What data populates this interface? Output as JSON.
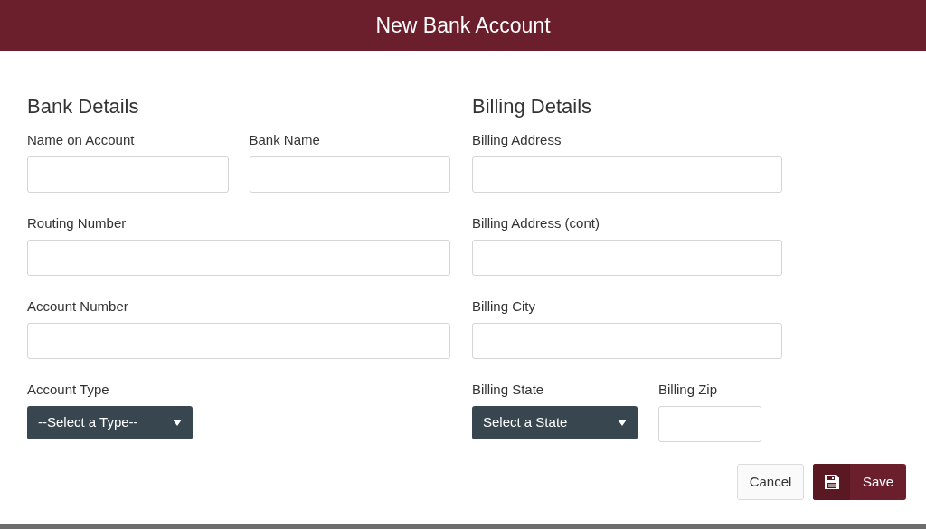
{
  "window": {
    "title": "New Bank Account"
  },
  "sections": [
    {
      "title": "Bank Details",
      "rows": [
        [
          {
            "label": "Name on Account",
            "kind": "text"
          },
          {
            "label": "Bank Name",
            "kind": "text"
          }
        ],
        [
          {
            "label": "Routing Number",
            "kind": "text"
          }
        ],
        [
          {
            "label": "Account Number",
            "kind": "text"
          }
        ],
        [
          {
            "label": "Account Type",
            "kind": "select",
            "value": "--Select a Type--"
          }
        ]
      ]
    },
    {
      "title": "Billing Details",
      "rows": [
        [
          {
            "label": "Billing Address",
            "kind": "text"
          }
        ],
        [
          {
            "label": "Billing Address (cont)",
            "kind": "text"
          }
        ],
        [
          {
            "label": "Billing City",
            "kind": "text"
          }
        ],
        [
          {
            "label": "Billing State",
            "kind": "select",
            "value": "Select a State"
          },
          {
            "label": "Billing Zip",
            "kind": "text"
          }
        ]
      ]
    }
  ],
  "buttons": [
    {
      "label": "Cancel",
      "kind": "cancel"
    },
    {
      "label": "Save",
      "kind": "save"
    }
  ]
}
